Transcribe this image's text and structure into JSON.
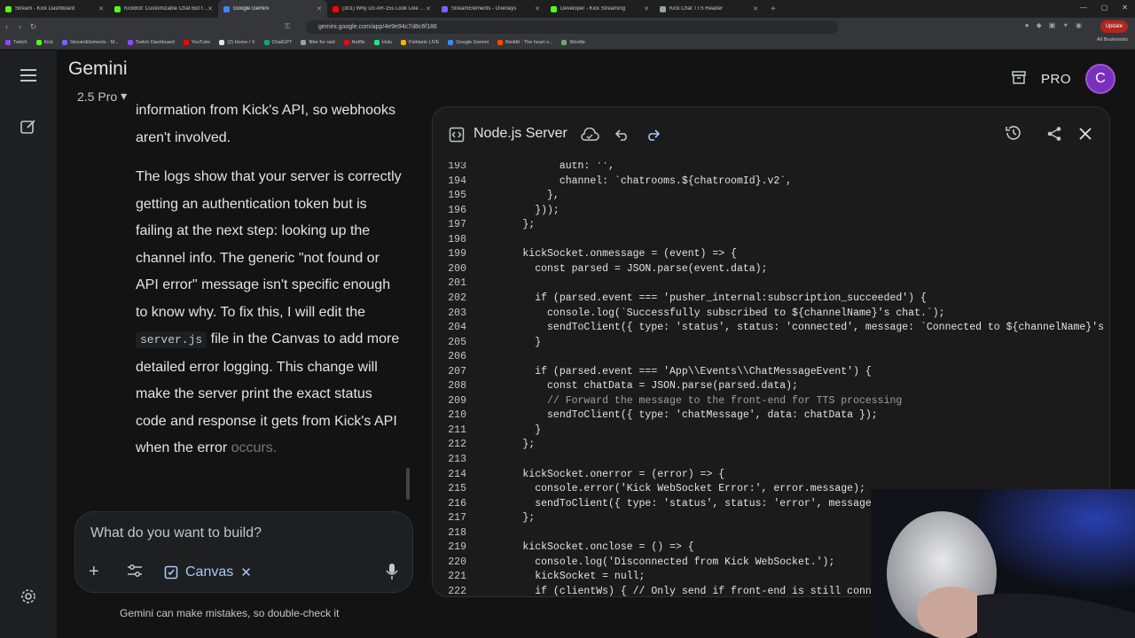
{
  "browser": {
    "tabs": [
      {
        "title": "Stream - Kick Dashboard",
        "color": "#53fc18",
        "active": false
      },
      {
        "title": "KickBot: Customizable Chat Bot for Ki",
        "color": "#53fc18",
        "active": false
      },
      {
        "title": "Google Gemini",
        "color": "#4285f4",
        "active": true
      },
      {
        "title": "(301) Why Do AR-15s Look Like THIS",
        "color": "#ff0000",
        "active": false
      },
      {
        "title": "StreamElements - Overlays",
        "color": "#7b61ff",
        "active": false
      },
      {
        "title": "Developer - Kick Streaming",
        "color": "#53fc18",
        "active": false
      },
      {
        "title": "Kick Chat TTS Reader",
        "color": "#9aa0a6",
        "active": false
      }
    ],
    "url": "gemini.google.com/app/4e9e94c7d8c6f186",
    "update_label": "Update",
    "bookmarks": [
      {
        "label": "Twitch",
        "color": "#9146ff"
      },
      {
        "label": "Kick",
        "color": "#53fc18"
      },
      {
        "label": "StreamElements - M...",
        "color": "#7b61ff"
      },
      {
        "label": "Twitch Dashboard",
        "color": "#9146ff"
      },
      {
        "label": "YouTube",
        "color": "#ff0000"
      },
      {
        "label": "(2) Home / X",
        "color": "#e3e3e3"
      },
      {
        "label": "ChatGPT",
        "color": "#10a37f"
      },
      {
        "label": "filter for raid",
        "color": "#9aa0a6"
      },
      {
        "label": "Netflix",
        "color": "#e50914"
      },
      {
        "label": "Hulu",
        "color": "#1ce783"
      },
      {
        "label": "Fishtank LIVE",
        "color": "#f4b400"
      },
      {
        "label": "Google Gemini",
        "color": "#4285f4"
      },
      {
        "label": "Reddit - The heart o...",
        "color": "#ff4500"
      },
      {
        "label": "Wordle",
        "color": "#6aaa64"
      }
    ],
    "all_bookmarks": "All Bookmarks"
  },
  "app": {
    "brand": "Gemini",
    "model": "2.5 Pro",
    "pro_label": "PRO",
    "avatar_initial": "C"
  },
  "chat": {
    "para1_tail": "information from Kick's API, so webhooks aren't involved.",
    "para2_a": "The logs show that your server is correctly getting an authentication token but is failing at the next step: looking up the channel info. The generic \"not found or API error\" message isn't specific enough to know why. To fix this, I will edit the",
    "para2_code": "server.js",
    "para2_b": "file in the Canvas to add more detailed error logging. This change will make the server print the exact status code and response it gets from Kick's API when the error",
    "para2_fade": "occurs."
  },
  "input": {
    "placeholder": "What do you want to build?",
    "chip_label": "Canvas"
  },
  "disclaimer": "Gemini can make mistakes, so double-check it",
  "canvas": {
    "title": "Node.js Server",
    "lines": [
      {
        "n": "193",
        "t": "            auth: '',"
      },
      {
        "n": "194",
        "t": "            channel: `chatrooms.${chatroomId}.v2`,"
      },
      {
        "n": "195",
        "t": "          },"
      },
      {
        "n": "196",
        "t": "        }));"
      },
      {
        "n": "197",
        "t": "      };"
      },
      {
        "n": "198",
        "t": ""
      },
      {
        "n": "199",
        "t": "      kickSocket.onmessage = (event) => {"
      },
      {
        "n": "200",
        "t": "        const parsed = JSON.parse(event.data);"
      },
      {
        "n": "201",
        "t": ""
      },
      {
        "n": "202",
        "t": "        if (parsed.event === 'pusher_internal:subscription_succeeded') {"
      },
      {
        "n": "203",
        "t": "          console.log(`Successfully subscribed to ${channelName}'s chat.`);"
      },
      {
        "n": "204",
        "t": "          sendToClient({ type: 'status', status: 'connected', message: `Connected to ${channelName}'s chat.` });"
      },
      {
        "n": "205",
        "t": "        }"
      },
      {
        "n": "206",
        "t": ""
      },
      {
        "n": "207",
        "t": "        if (parsed.event === 'App\\\\Events\\\\ChatMessageEvent') {"
      },
      {
        "n": "208",
        "t": "          const chatData = JSON.parse(parsed.data);"
      },
      {
        "n": "209",
        "t": "          // Forward the message to the front-end for TTS processing"
      },
      {
        "n": "210",
        "t": "          sendToClient({ type: 'chatMessage', data: chatData });"
      },
      {
        "n": "211",
        "t": "        }"
      },
      {
        "n": "212",
        "t": "      };"
      },
      {
        "n": "213",
        "t": ""
      },
      {
        "n": "214",
        "t": "      kickSocket.onerror = (error) => {"
      },
      {
        "n": "215",
        "t": "        console.error('Kick WebSocket Error:', error.message);"
      },
      {
        "n": "216",
        "t": "        sendToClient({ type: 'status', status: 'error', message: 'Kick connection error.' });"
      },
      {
        "n": "217",
        "t": "      };"
      },
      {
        "n": "218",
        "t": ""
      },
      {
        "n": "219",
        "t": "      kickSocket.onclose = () => {"
      },
      {
        "n": "220",
        "t": "        console.log('Disconnected from Kick WebSocket.');"
      },
      {
        "n": "221",
        "t": "        kickSocket = null;"
      },
      {
        "n": "222",
        "t": "        if (clientWs) { // Only send if front-end is still connected"
      }
    ]
  }
}
